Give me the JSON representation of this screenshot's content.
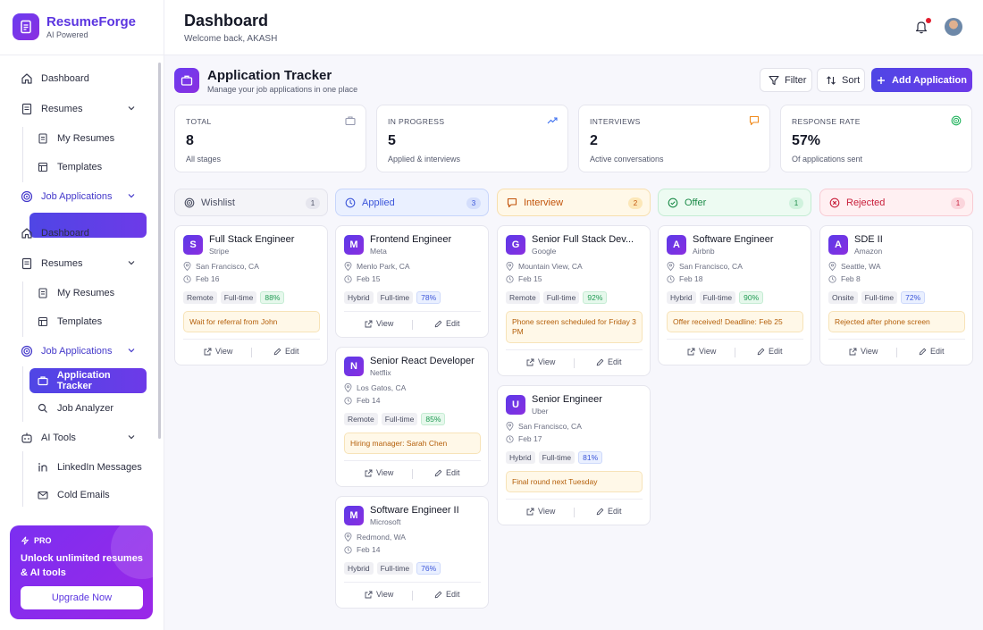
{
  "brand": {
    "name": "ResumeForge",
    "tagline": "AI Powered"
  },
  "nav": {
    "items1": {
      "dashboard": "Dashboard",
      "resumes": "Resumes",
      "my_resumes": "My Resumes",
      "templates": "Templates",
      "job_applications": "Job Applications"
    },
    "items2": {
      "dashboard": "Dashboard",
      "resumes": "Resumes",
      "my_resumes": "My Resumes",
      "templates": "Templates",
      "job_applications": "Job Applications",
      "application_tracker": "Application Tracker",
      "job_analyzer": "Job Analyzer",
      "ai_tools": "AI Tools",
      "linkedin_messages": "LinkedIn Messages",
      "cold_emails": "Cold Emails"
    }
  },
  "promo": {
    "badge": "PRO",
    "text": "Unlock unlimited resumes & AI tools",
    "button": "Upgrade Now"
  },
  "header": {
    "title": "Dashboard",
    "subtitle": "Welcome back, AKASH"
  },
  "tracker": {
    "title": "Application Tracker",
    "subtitle": "Manage your job applications in one place",
    "filter": "Filter",
    "sort": "Sort",
    "add": "Add Application"
  },
  "stats": [
    {
      "label": "TOTAL",
      "value": "8",
      "sub": "All stages",
      "icon": "briefcase-icon",
      "color": "#9498ae"
    },
    {
      "label": "IN PROGRESS",
      "value": "5",
      "sub": "Applied & interviews",
      "icon": "trending-up-icon",
      "color": "#3b6ef0"
    },
    {
      "label": "INTERVIEWS",
      "value": "2",
      "sub": "Active conversations",
      "icon": "chat-icon",
      "color": "#f08a1c"
    },
    {
      "label": "RESPONSE RATE",
      "value": "57%",
      "sub": "Of applications sent",
      "icon": "target-icon",
      "color": "#22b35e"
    }
  ],
  "columns": [
    {
      "name": "Wishlist",
      "count": "1",
      "icon": "target-icon",
      "color": "#4b4f63",
      "bg": "#f4f4f8",
      "border": "#e3e3ec",
      "badge_bg": "#e6e6ee",
      "cards": [
        {
          "initial": "S",
          "title": "Full Stack Engineer",
          "company": "Stripe",
          "location": "San Francisco, CA",
          "date": "Feb 16",
          "tags": [
            "Remote",
            "Full-time"
          ],
          "score": "88%",
          "score_color": "green",
          "note": "Wait for referral from John"
        }
      ]
    },
    {
      "name": "Applied",
      "count": "3",
      "icon": "clock-icon",
      "color": "#3b55d9",
      "bg": "#eaf0ff",
      "border": "#c7d5fb",
      "badge_bg": "#d4defc",
      "cards": [
        {
          "initial": "M",
          "title": "Frontend Engineer",
          "company": "Meta",
          "location": "Menlo Park, CA",
          "date": "Feb 15",
          "tags": [
            "Hybrid",
            "Full-time"
          ],
          "score": "78%",
          "score_color": "blue",
          "note": ""
        },
        {
          "initial": "N",
          "title": "Senior React Developer",
          "company": "Netflix",
          "location": "Los Gatos, CA",
          "date": "Feb 14",
          "tags": [
            "Remote",
            "Full-time"
          ],
          "score": "85%",
          "score_color": "green",
          "note": "Hiring manager: Sarah Chen"
        },
        {
          "initial": "M",
          "title": "Software Engineer II",
          "company": "Microsoft",
          "location": "Redmond, WA",
          "date": "Feb 14",
          "tags": [
            "Hybrid",
            "Full-time"
          ],
          "score": "76%",
          "score_color": "blue",
          "note": ""
        }
      ]
    },
    {
      "name": "Interview",
      "count": "2",
      "icon": "chat-icon",
      "color": "#c2530a",
      "bg": "#fff8e8",
      "border": "#f7dfae",
      "badge_bg": "#fce7b8",
      "cards": [
        {
          "initial": "G",
          "title": "Senior Full Stack Dev...",
          "company": "Google",
          "location": "Mountain View, CA",
          "date": "Feb 15",
          "tags": [
            "Remote",
            "Full-time"
          ],
          "score": "92%",
          "score_color": "green",
          "note": "Phone screen scheduled for Friday 3 PM"
        },
        {
          "initial": "U",
          "title": "Senior Engineer",
          "company": "Uber",
          "location": "San Francisco, CA",
          "date": "Feb 17",
          "tags": [
            "Hybrid",
            "Full-time"
          ],
          "score": "81%",
          "score_color": "blue",
          "note": "Final round next Tuesday"
        }
      ]
    },
    {
      "name": "Offer",
      "count": "1",
      "icon": "check-circle-icon",
      "color": "#1a8a47",
      "bg": "#edfbf2",
      "border": "#c4ecd3",
      "badge_bg": "#d0f2dd",
      "cards": [
        {
          "initial": "A",
          "title": "Software Engineer",
          "company": "Airbnb",
          "location": "San Francisco, CA",
          "date": "Feb 18",
          "tags": [
            "Hybrid",
            "Full-time"
          ],
          "score": "90%",
          "score_color": "green",
          "note": "Offer received! Deadline: Feb 25"
        }
      ]
    },
    {
      "name": "Rejected",
      "count": "1",
      "icon": "x-circle-icon",
      "color": "#c81e3a",
      "bg": "#fff0f2",
      "border": "#f8cbd3",
      "badge_bg": "#fbd5dc",
      "cards": [
        {
          "initial": "A",
          "title": "SDE II",
          "company": "Amazon",
          "location": "Seattle, WA",
          "date": "Feb 8",
          "tags": [
            "Onsite",
            "Full-time"
          ],
          "score": "72%",
          "score_color": "blue",
          "note": "Rejected after phone screen"
        }
      ]
    }
  ],
  "card_actions": {
    "view": "View",
    "edit": "Edit"
  }
}
